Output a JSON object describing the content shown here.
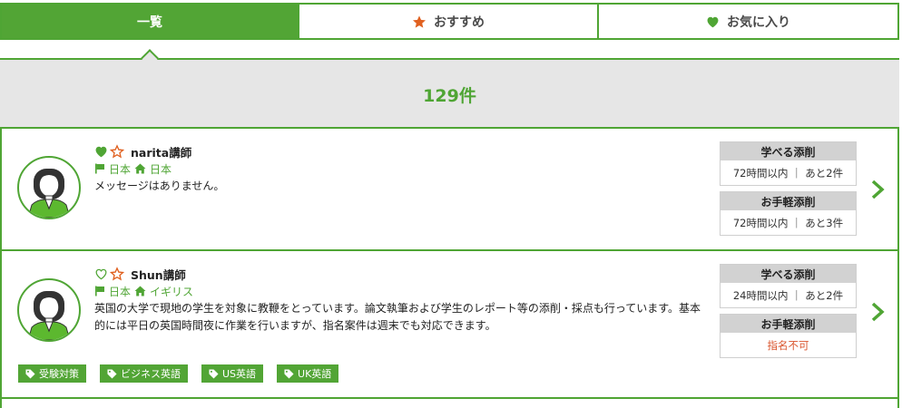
{
  "tabs": [
    {
      "label": "一覧",
      "icon": "none",
      "active": true
    },
    {
      "label": "おすすめ",
      "icon": "star-icon",
      "active": false
    },
    {
      "label": "お気に入り",
      "icon": "heart-icon",
      "active": false
    }
  ],
  "result_count": "129件",
  "teachers": [
    {
      "name": "narita講師",
      "favorited": true,
      "nationality": "日本",
      "residence": "日本",
      "message": "メッセージはありません。",
      "plans": [
        {
          "title": "学べる添削",
          "detail": "72時間以内 ｜ あと2件"
        },
        {
          "title": "お手軽添削",
          "detail": "72時間以内 ｜ あと3件"
        }
      ],
      "tags": []
    },
    {
      "name": "Shun講師",
      "favorited": false,
      "nationality": "日本",
      "residence": "イギリス",
      "message": "英国の大学で現地の学生を対象に教鞭をとっています。論文執筆および学生のレポート等の添削・採点も行っています。基本的には平日の英国時間夜に作業を行いますが、指名案件は週末でも対応できます。",
      "plans": [
        {
          "title": "学べる添削",
          "detail": "24時間以内 ｜ あと2件"
        },
        {
          "title": "お手軽添削",
          "detail": "指名不可"
        }
      ],
      "tags": [
        "受験対策",
        "ビジネス英語",
        "US英語",
        "UK英語"
      ]
    }
  ],
  "colors": {
    "brand_green": "#4fa534",
    "star_orange": "#e0601f",
    "unavailable_red": "#d9532b",
    "band_gray": "#e6e6e6"
  }
}
